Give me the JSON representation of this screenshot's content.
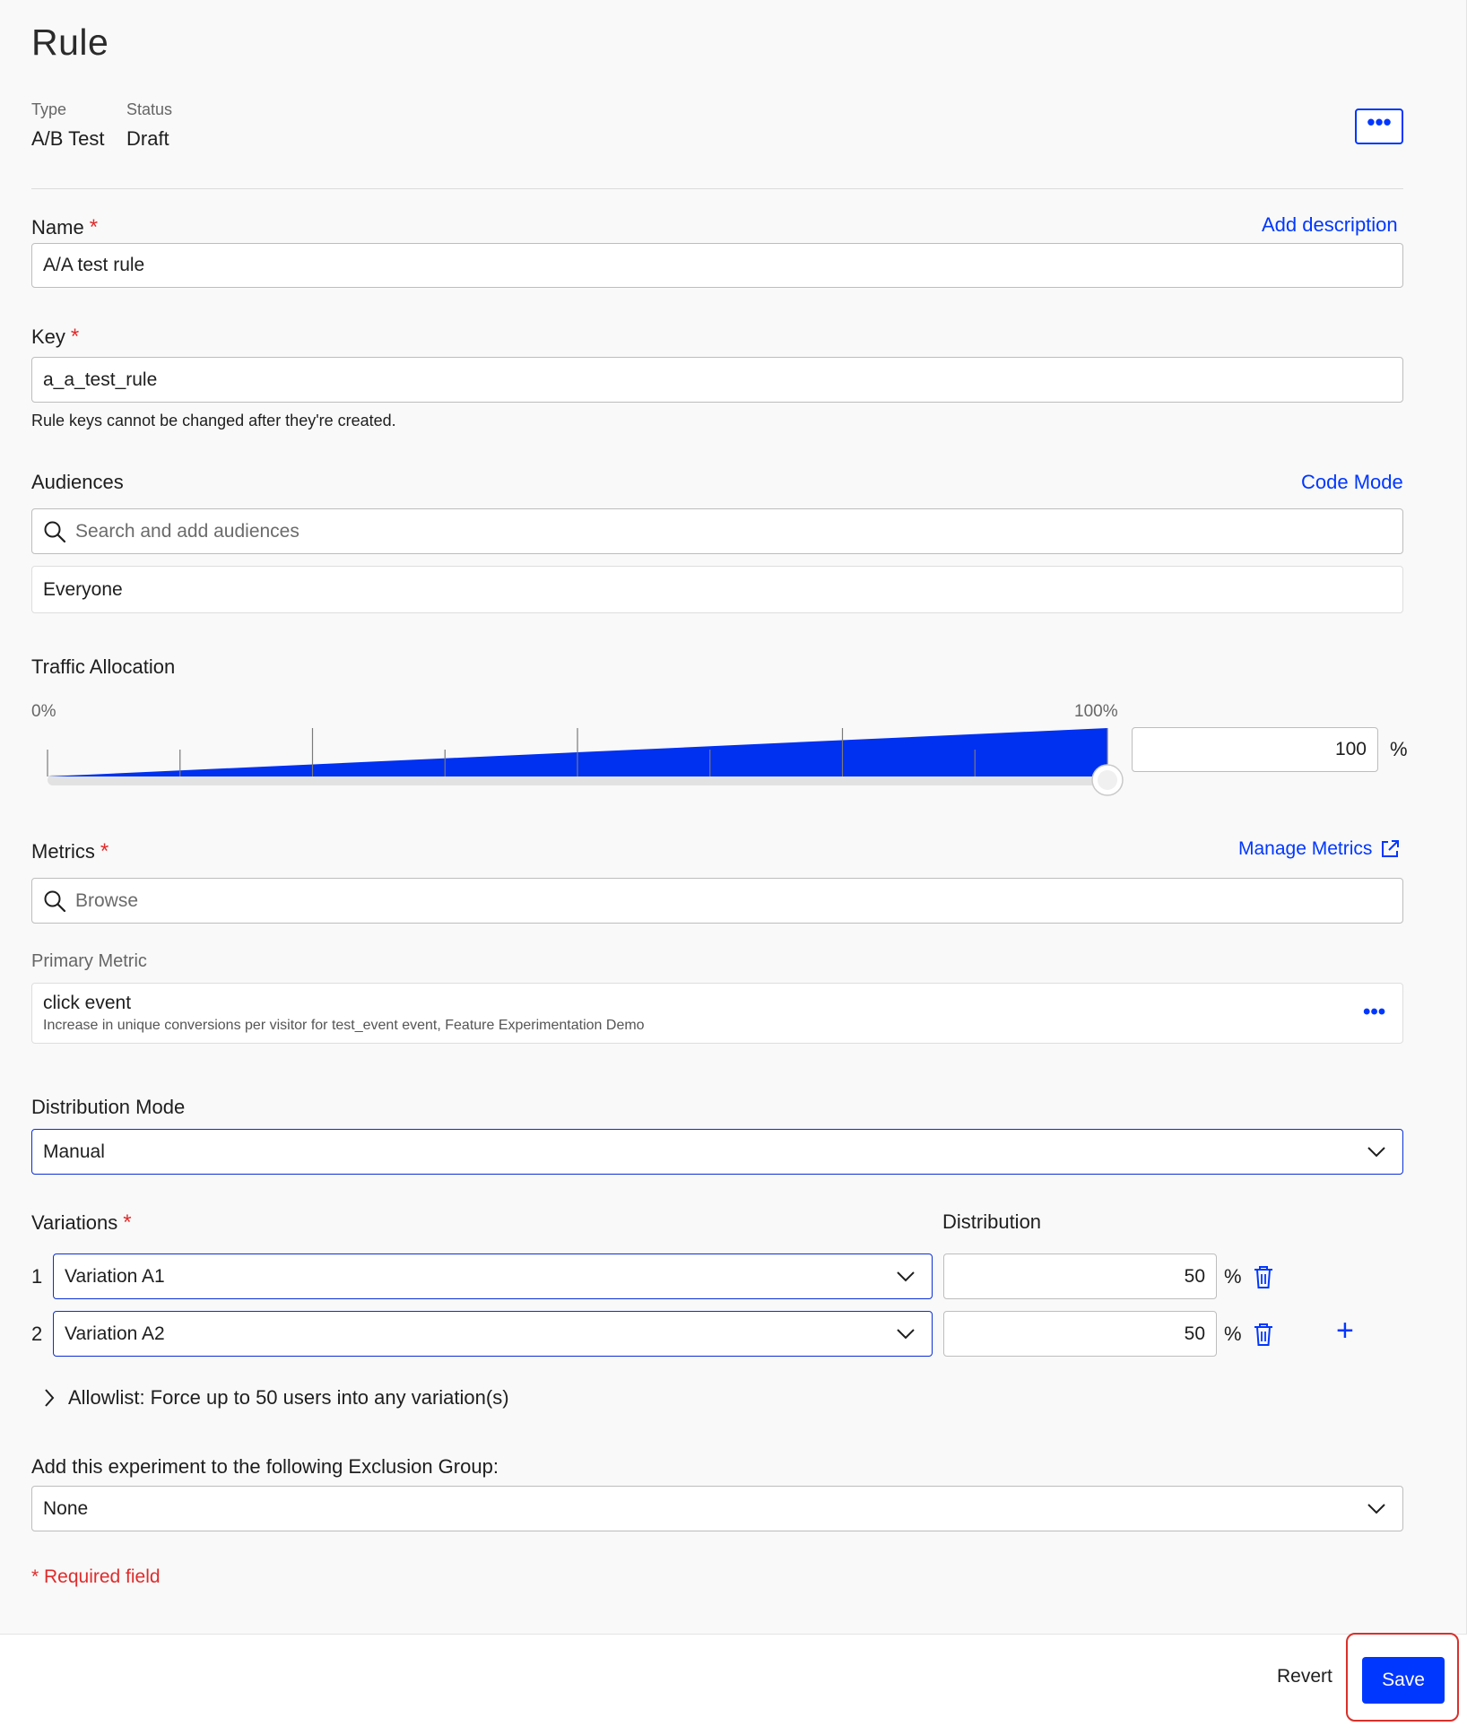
{
  "header": {
    "title": "Rule",
    "type_label": "Type",
    "type_value": "A/B Test",
    "status_label": "Status",
    "status_value": "Draft",
    "more_button": "•••"
  },
  "name": {
    "label": "Name",
    "required_mark": "*",
    "value": "A/A test rule",
    "add_description_link": "Add description"
  },
  "key": {
    "label": "Key",
    "required_mark": "*",
    "value": "a_a_test_rule",
    "helper": "Rule keys cannot be changed after they're created."
  },
  "audiences": {
    "label": "Audiences",
    "code_mode_link": "Code Mode",
    "search_placeholder": "Search and add audiences",
    "selected": "Everyone"
  },
  "traffic": {
    "label": "Traffic Allocation",
    "min_label": "0%",
    "max_label": "100%",
    "value": "100",
    "unit": "%",
    "level_fraction": 1.0
  },
  "metrics": {
    "label": "Metrics",
    "required_mark": "*",
    "manage_link": "Manage Metrics",
    "browse_placeholder": "Browse",
    "primary_label": "Primary Metric",
    "primary_name": "click event",
    "primary_description": "Increase in unique conversions per visitor for test_event event, Feature Experimentation Demo",
    "more_button": "•••"
  },
  "distribution_mode": {
    "label": "Distribution Mode",
    "selected": "Manual"
  },
  "variations": {
    "label": "Variations",
    "required_mark": "*",
    "distribution_label": "Distribution",
    "items": [
      {
        "index": "1",
        "name": "Variation A1",
        "percent": "50",
        "unit": "%"
      },
      {
        "index": "2",
        "name": "Variation A2",
        "percent": "50",
        "unit": "%"
      }
    ],
    "add_button": "+"
  },
  "allowlist": {
    "label": "Allowlist: Force up to 50 users into any variation(s)"
  },
  "exclusion": {
    "label": "Add this experiment to the following Exclusion Group:",
    "selected": "None"
  },
  "required_note": "* Required field",
  "footer": {
    "revert": "Revert",
    "save": "Save"
  },
  "colors": {
    "accent": "#0037ff",
    "required": "#e02b2b",
    "highlight_outline": "#d9302b"
  }
}
